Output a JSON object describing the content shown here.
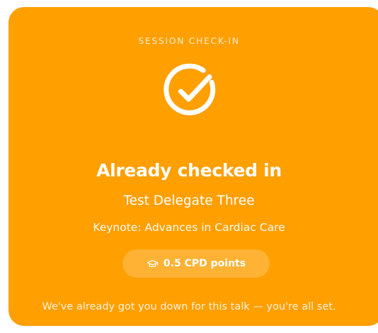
{
  "card": {
    "eyebrow": "SESSION CHECK-IN",
    "status_icon": "check-circle-icon",
    "title": "Already checked in",
    "delegate_name": "Test Delegate Three",
    "session_title": "Keynote: Advances in Cardiac Care",
    "cpd": {
      "icon": "graduation-cap-icon",
      "label": "0.5 CPD points"
    },
    "note": "We've already got you down for this talk — you're all set."
  },
  "colors": {
    "card_background": "#FF9F00",
    "text": "#FFFFFF"
  }
}
